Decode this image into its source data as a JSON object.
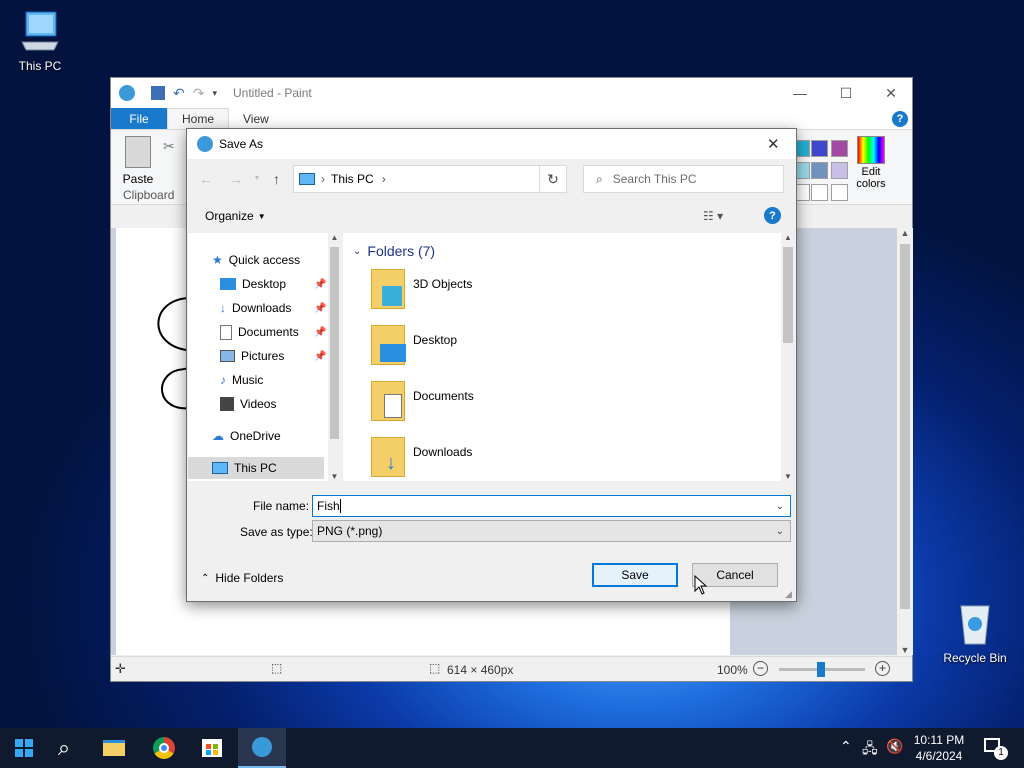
{
  "desktop": {
    "this_pc_label": "This PC",
    "recycle_bin_label": "Recycle Bin"
  },
  "paint": {
    "title": "Untitled - Paint",
    "tabs": {
      "file": "File",
      "home": "Home",
      "view": "View"
    },
    "paste_label": "Paste",
    "clipboard_label": "Clipboard",
    "edit_colors_line1": "Edit",
    "edit_colors_line2": "colors",
    "status": {
      "dimensions": "614 × 460px",
      "zoom": "100%"
    },
    "palette_colors": [
      "#22b1d6",
      "#3f48cc",
      "#a349a4",
      "#99d9ea",
      "#7092be",
      "#c8bfe7"
    ]
  },
  "dialog": {
    "title": "Save As",
    "address": {
      "location": "This PC"
    },
    "search_placeholder": "Search This PC",
    "organize_label": "Organize",
    "nav": {
      "quick_access": "Quick access",
      "items": [
        "Desktop",
        "Downloads",
        "Documents",
        "Pictures",
        "Music",
        "Videos"
      ],
      "onedrive": "OneDrive",
      "this_pc": "This PC"
    },
    "folders_header": "Folders (7)",
    "folders": [
      "3D Objects",
      "Desktop",
      "Documents",
      "Downloads"
    ],
    "file_name_label": "File name:",
    "file_name_value": "Fish",
    "save_type_label": "Save as type:",
    "save_type_value": "PNG (*.png)",
    "hide_folders_label": "Hide Folders",
    "save_label": "Save",
    "cancel_label": "Cancel"
  },
  "taskbar": {
    "time": "10:11 PM",
    "date": "4/6/2024",
    "notification_count": "1"
  },
  "colors": {
    "accent": "#0078d7",
    "file_tab": "#1979ca"
  }
}
